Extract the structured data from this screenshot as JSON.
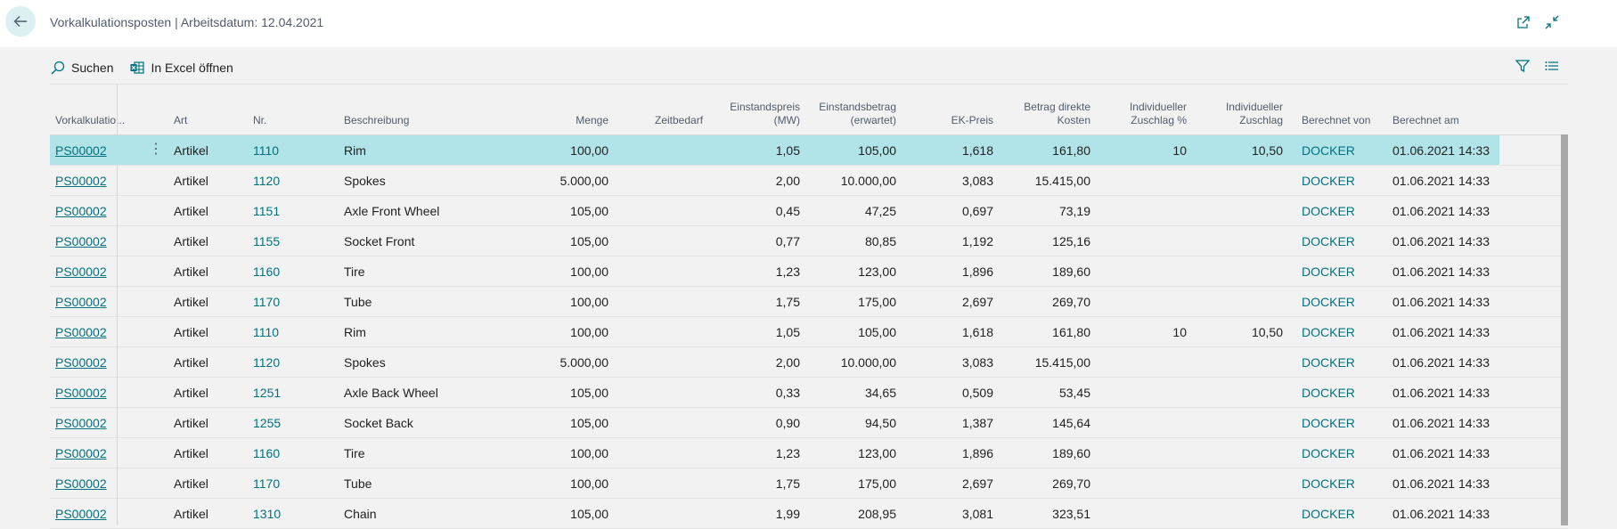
{
  "header": {
    "title": "Vorkalkulationsposten | Arbeitsdatum: 12.04.2021"
  },
  "toolbar": {
    "search_label": "Suchen",
    "excel_label": "In Excel öffnen"
  },
  "columns": {
    "vorkalk": "Vorkalkulatio...",
    "art": "Art",
    "nr": "Nr.",
    "beschreibung": "Beschreibung",
    "menge": "Menge",
    "zeitbedarf": "Zeitbedarf",
    "einstandspreis_1": "Einstandspreis",
    "einstandspreis_2": "(MW)",
    "einstandsbetrag_1": "Einstandsbetrag",
    "einstandsbetrag_2": "(erwartet)",
    "ekpreis": "EK-Preis",
    "betrag_1": "Betrag direkte",
    "betrag_2": "Kosten",
    "zuschlagp_1": "Individueller",
    "zuschlagp_2": "Zuschlag %",
    "zuschlag_1": "Individueller",
    "zuschlag_2": "Zuschlag",
    "berechnet_von": "Berechnet von",
    "berechnet_am": "Berechnet am"
  },
  "rows": [
    {
      "vorkalk": "PS00002",
      "art": "Artikel",
      "nr": "1110",
      "beschreibung": "Rim",
      "menge": "100,00",
      "zeitbedarf": "",
      "einstandspreis": "1,05",
      "einstandsbetrag": "105,00",
      "ekpreis": "1,618",
      "betrag": "161,80",
      "zuschlagp": "10",
      "zuschlag": "10,50",
      "von": "DOCKER",
      "am": "01.06.2021 14:33"
    },
    {
      "vorkalk": "PS00002",
      "art": "Artikel",
      "nr": "1120",
      "beschreibung": "Spokes",
      "menge": "5.000,00",
      "zeitbedarf": "",
      "einstandspreis": "2,00",
      "einstandsbetrag": "10.000,00",
      "ekpreis": "3,083",
      "betrag": "15.415,00",
      "zuschlagp": "",
      "zuschlag": "",
      "von": "DOCKER",
      "am": "01.06.2021 14:33"
    },
    {
      "vorkalk": "PS00002",
      "art": "Artikel",
      "nr": "1151",
      "beschreibung": "Axle Front Wheel",
      "menge": "105,00",
      "zeitbedarf": "",
      "einstandspreis": "0,45",
      "einstandsbetrag": "47,25",
      "ekpreis": "0,697",
      "betrag": "73,19",
      "zuschlagp": "",
      "zuschlag": "",
      "von": "DOCKER",
      "am": "01.06.2021 14:33"
    },
    {
      "vorkalk": "PS00002",
      "art": "Artikel",
      "nr": "1155",
      "beschreibung": "Socket Front",
      "menge": "105,00",
      "zeitbedarf": "",
      "einstandspreis": "0,77",
      "einstandsbetrag": "80,85",
      "ekpreis": "1,192",
      "betrag": "125,16",
      "zuschlagp": "",
      "zuschlag": "",
      "von": "DOCKER",
      "am": "01.06.2021 14:33"
    },
    {
      "vorkalk": "PS00002",
      "art": "Artikel",
      "nr": "1160",
      "beschreibung": "Tire",
      "menge": "100,00",
      "zeitbedarf": "",
      "einstandspreis": "1,23",
      "einstandsbetrag": "123,00",
      "ekpreis": "1,896",
      "betrag": "189,60",
      "zuschlagp": "",
      "zuschlag": "",
      "von": "DOCKER",
      "am": "01.06.2021 14:33"
    },
    {
      "vorkalk": "PS00002",
      "art": "Artikel",
      "nr": "1170",
      "beschreibung": "Tube",
      "menge": "100,00",
      "zeitbedarf": "",
      "einstandspreis": "1,75",
      "einstandsbetrag": "175,00",
      "ekpreis": "2,697",
      "betrag": "269,70",
      "zuschlagp": "",
      "zuschlag": "",
      "von": "DOCKER",
      "am": "01.06.2021 14:33"
    },
    {
      "vorkalk": "PS00002",
      "art": "Artikel",
      "nr": "1110",
      "beschreibung": "Rim",
      "menge": "100,00",
      "zeitbedarf": "",
      "einstandspreis": "1,05",
      "einstandsbetrag": "105,00",
      "ekpreis": "1,618",
      "betrag": "161,80",
      "zuschlagp": "10",
      "zuschlag": "10,50",
      "von": "DOCKER",
      "am": "01.06.2021 14:33"
    },
    {
      "vorkalk": "PS00002",
      "art": "Artikel",
      "nr": "1120",
      "beschreibung": "Spokes",
      "menge": "5.000,00",
      "zeitbedarf": "",
      "einstandspreis": "2,00",
      "einstandsbetrag": "10.000,00",
      "ekpreis": "3,083",
      "betrag": "15.415,00",
      "zuschlagp": "",
      "zuschlag": "",
      "von": "DOCKER",
      "am": "01.06.2021 14:33"
    },
    {
      "vorkalk": "PS00002",
      "art": "Artikel",
      "nr": "1251",
      "beschreibung": "Axle Back Wheel",
      "menge": "105,00",
      "zeitbedarf": "",
      "einstandspreis": "0,33",
      "einstandsbetrag": "34,65",
      "ekpreis": "0,509",
      "betrag": "53,45",
      "zuschlagp": "",
      "zuschlag": "",
      "von": "DOCKER",
      "am": "01.06.2021 14:33"
    },
    {
      "vorkalk": "PS00002",
      "art": "Artikel",
      "nr": "1255",
      "beschreibung": "Socket Back",
      "menge": "105,00",
      "zeitbedarf": "",
      "einstandspreis": "0,90",
      "einstandsbetrag": "94,50",
      "ekpreis": "1,387",
      "betrag": "145,64",
      "zuschlagp": "",
      "zuschlag": "",
      "von": "DOCKER",
      "am": "01.06.2021 14:33"
    },
    {
      "vorkalk": "PS00002",
      "art": "Artikel",
      "nr": "1160",
      "beschreibung": "Tire",
      "menge": "100,00",
      "zeitbedarf": "",
      "einstandspreis": "1,23",
      "einstandsbetrag": "123,00",
      "ekpreis": "1,896",
      "betrag": "189,60",
      "zuschlagp": "",
      "zuschlag": "",
      "von": "DOCKER",
      "am": "01.06.2021 14:33"
    },
    {
      "vorkalk": "PS00002",
      "art": "Artikel",
      "nr": "1170",
      "beschreibung": "Tube",
      "menge": "100,00",
      "zeitbedarf": "",
      "einstandspreis": "1,75",
      "einstandsbetrag": "175,00",
      "ekpreis": "2,697",
      "betrag": "269,70",
      "zuschlagp": "",
      "zuschlag": "",
      "von": "DOCKER",
      "am": "01.06.2021 14:33"
    },
    {
      "vorkalk": "PS00002",
      "art": "Artikel",
      "nr": "1310",
      "beschreibung": "Chain",
      "menge": "105,00",
      "zeitbedarf": "",
      "einstandspreis": "1,99",
      "einstandsbetrag": "208,95",
      "ekpreis": "3,081",
      "betrag": "323,51",
      "zuschlagp": "",
      "zuschlag": "",
      "von": "DOCKER",
      "am": "01.06.2021 14:33"
    }
  ],
  "colors": {
    "accent": "#00727f",
    "selected_row": "#b1e4e8"
  },
  "icons": {
    "back": "arrow-left-icon",
    "open_new": "open-in-new-window-icon",
    "collapse": "collapse-icon",
    "search": "search-icon",
    "excel": "excel-icon",
    "filter": "filter-icon",
    "list": "list-view-icon"
  }
}
